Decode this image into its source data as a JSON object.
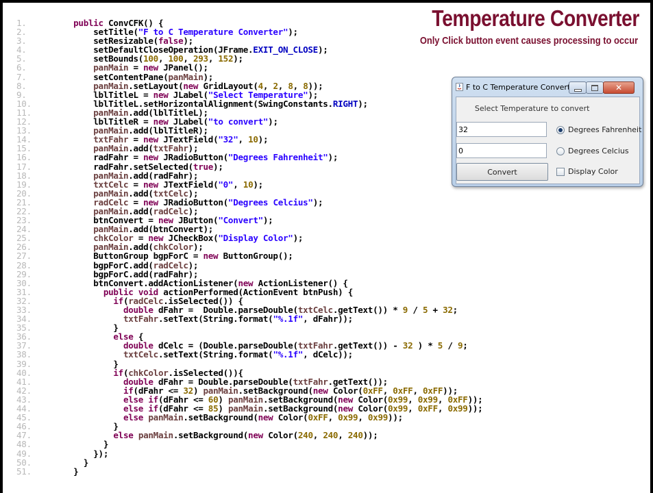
{
  "slide": {
    "title": "Temperature Converter",
    "subtitle": "Only Click button event causes processing to occur"
  },
  "code_lines": [
    {
      "n": "1.",
      "t": "    public ConvCFK() {"
    },
    {
      "n": "2.",
      "t": "        setTitle(\"F to C Temperature Converter\");"
    },
    {
      "n": "3.",
      "t": "        setResizable(false);"
    },
    {
      "n": "4.",
      "t": "        setDefaultCloseOperation(JFrame.EXIT_ON_CLOSE);"
    },
    {
      "n": "5.",
      "t": "        setBounds(100, 100, 293, 152);"
    },
    {
      "n": "6.",
      "t": "        panMain = new JPanel();"
    },
    {
      "n": "7.",
      "t": "        setContentPane(panMain);"
    },
    {
      "n": "8.",
      "t": "        panMain.setLayout(new GridLayout(4, 2, 8, 8));"
    },
    {
      "n": "9.",
      "t": "        lblTitleL = new JLabel(\"Select Temperature\");"
    },
    {
      "n": "10.",
      "t": "        lblTitleL.setHorizontalAlignment(SwingConstants.RIGHT);"
    },
    {
      "n": "11.",
      "t": "        panMain.add(lblTitleL);"
    },
    {
      "n": "12.",
      "t": "        lblTitleR = new JLabel(\"to convert\");"
    },
    {
      "n": "13.",
      "t": "        panMain.add(lblTitleR);"
    },
    {
      "n": "14.",
      "t": "        txtFahr = new JTextField(\"32\", 10);"
    },
    {
      "n": "15.",
      "t": "        panMain.add(txtFahr);"
    },
    {
      "n": "16.",
      "t": "        radFahr = new JRadioButton(\"Degrees Fahrenheit\");"
    },
    {
      "n": "17.",
      "t": "        radFahr.setSelected(true);"
    },
    {
      "n": "18.",
      "t": "        panMain.add(radFahr);"
    },
    {
      "n": "19.",
      "t": "        txtCelc = new JTextField(\"0\", 10);"
    },
    {
      "n": "20.",
      "t": "        panMain.add(txtCelc);"
    },
    {
      "n": "21.",
      "t": "        radCelc = new JRadioButton(\"Degrees Celcius\");"
    },
    {
      "n": "22.",
      "t": "        panMain.add(radCelc);"
    },
    {
      "n": "23.",
      "t": "        btnConvert = new JButton(\"Convert\");"
    },
    {
      "n": "24.",
      "t": "        panMain.add(btnConvert);"
    },
    {
      "n": "25.",
      "t": "        chkColor = new JCheckBox(\"Display Color\");"
    },
    {
      "n": "26.",
      "t": "        panMain.add(chkColor);"
    },
    {
      "n": "27.",
      "t": "        ButtonGroup bgpForC = new ButtonGroup();"
    },
    {
      "n": "28.",
      "t": "        bgpForC.add(radCelc);"
    },
    {
      "n": "29.",
      "t": "        bgpForC.add(radFahr);"
    },
    {
      "n": "30.",
      "t": "        btnConvert.addActionListener(new ActionListener() {"
    },
    {
      "n": "31.",
      "t": "          public void actionPerformed(ActionEvent btnPush) {"
    },
    {
      "n": "32.",
      "t": "            if(radCelc.isSelected()) {"
    },
    {
      "n": "33.",
      "t": "              double dFahr =  Double.parseDouble(txtCelc.getText()) * 9 / 5 + 32;"
    },
    {
      "n": "34.",
      "t": "              txtFahr.setText(String.format(\"%.1f\", dFahr));"
    },
    {
      "n": "35.",
      "t": "            }"
    },
    {
      "n": "36.",
      "t": "            else {"
    },
    {
      "n": "37.",
      "t": "              double dCelc = (Double.parseDouble(txtFahr.getText()) - 32 ) * 5 / 9;"
    },
    {
      "n": "38.",
      "t": "              txtCelc.setText(String.format(\"%.1f\", dCelc));"
    },
    {
      "n": "39.",
      "t": "            }"
    },
    {
      "n": "40.",
      "t": "            if(chkColor.isSelected()){"
    },
    {
      "n": "41.",
      "t": "              double dFahr = Double.parseDouble(txtFahr.getText());"
    },
    {
      "n": "42.",
      "t": "              if(dFahr <= 32) panMain.setBackground(new Color(0xFF, 0xFF, 0xFF));"
    },
    {
      "n": "43.",
      "t": "              else if(dFahr <= 60) panMain.setBackground(new Color(0x99, 0x99, 0xFF));"
    },
    {
      "n": "44.",
      "t": "              else if(dFahr <= 85) panMain.setBackground(new Color(0x99, 0xFF, 0x99));"
    },
    {
      "n": "45.",
      "t": "              else panMain.setBackground(new Color(0xFF, 0x99, 0x99));"
    },
    {
      "n": "46.",
      "t": "            }"
    },
    {
      "n": "47.",
      "t": "            else panMain.setBackground(new Color(240, 240, 240));"
    },
    {
      "n": "48.",
      "t": "          }"
    },
    {
      "n": "49.",
      "t": "        });"
    },
    {
      "n": "50.",
      "t": "      }"
    },
    {
      "n": "51.",
      "t": "    }"
    }
  ],
  "window": {
    "title": "F to C Temperature Converter",
    "label_left": "Select Temperature",
    "label_right": "to convert",
    "fahr_value": "32",
    "fahr_radio_label": "Degrees Fahrenheit",
    "fahr_selected": true,
    "celc_value": "0",
    "celc_radio_label": "Degrees Celcius",
    "celc_selected": false,
    "convert_label": "Convert",
    "color_checkbox_label": "Display Color",
    "color_checked": false
  },
  "colors": {
    "title": "#7a1030",
    "keyword": "#7f0055",
    "string": "#2a00ff",
    "line_number": "#b8b8b8"
  },
  "icons": [
    "java-icon",
    "minimize-icon",
    "maximize-icon",
    "close-icon"
  ]
}
